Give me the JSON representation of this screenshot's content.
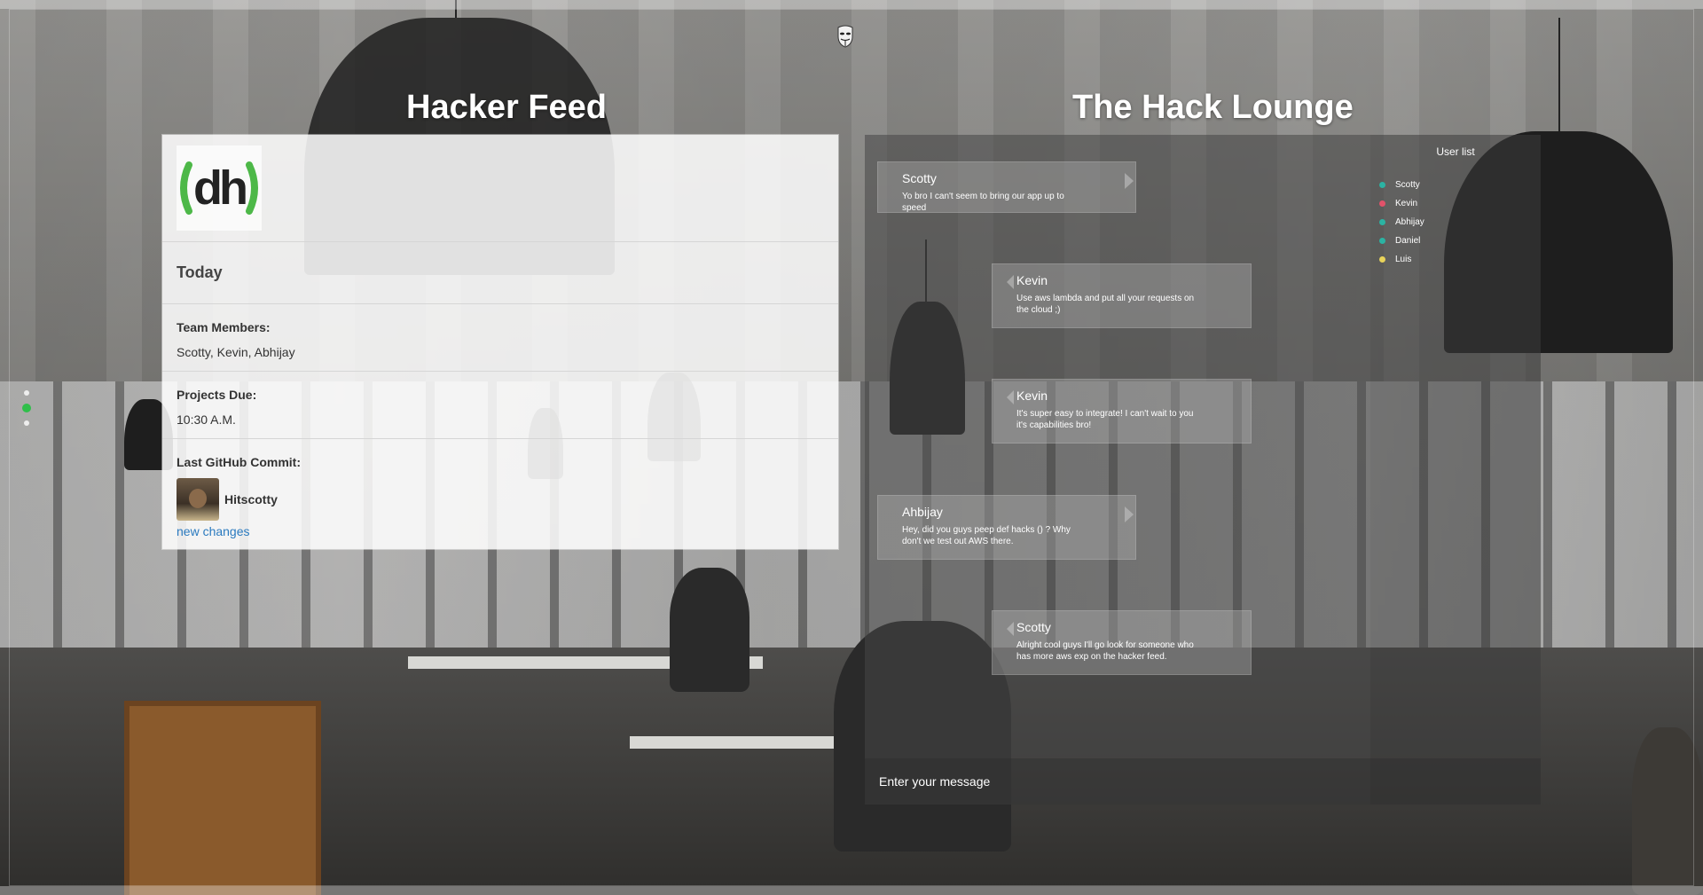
{
  "feed": {
    "title": "Hacker Feed",
    "logo": "dh",
    "today": "Today",
    "team_label": "Team Members:",
    "team_value": "Scotty, Kevin, Abhijay",
    "projects_label": "Projects Due:",
    "projects_value": "10:30 A.M.",
    "commit_label": "Last GitHub Commit:",
    "commit_user": "Hitscotty",
    "commit_link": "new changes"
  },
  "lounge": {
    "title": "The Hack Lounge",
    "messages": [
      {
        "author": "Scotty",
        "text": "Yo bro I can't seem to bring our app up to speed"
      },
      {
        "author": "Kevin",
        "text": "Use aws lambda and put all your requests on the cloud ;)"
      },
      {
        "author": "Kevin",
        "text": "It's super easy to integrate! I can't wait to you it's capabilities bro!"
      },
      {
        "author": "Ahbijay",
        "text": "Hey, did you guys peep def hacks () ? Why don't we test out AWS there."
      },
      {
        "author": "Scotty",
        "text": "Alright cool guys I'll go look for someone who has more aws exp on the hacker feed."
      }
    ],
    "input_placeholder": "Enter your message"
  },
  "user_list": {
    "title": "User list",
    "users": [
      {
        "name": "Scotty",
        "status_color": "#2bb3a3"
      },
      {
        "name": "Kevin",
        "status_color": "#e2526a"
      },
      {
        "name": "Abhijay",
        "status_color": "#2bb3a3"
      },
      {
        "name": "Daniel",
        "status_color": "#2bb3a3"
      },
      {
        "name": "Luis",
        "status_color": "#e8d35a"
      }
    ]
  },
  "icons": {
    "top": "anonymous-mask-icon"
  },
  "colors": {
    "logo_green": "#4db848",
    "link": "#2a7abf",
    "active_dot": "#2fbf4a"
  }
}
